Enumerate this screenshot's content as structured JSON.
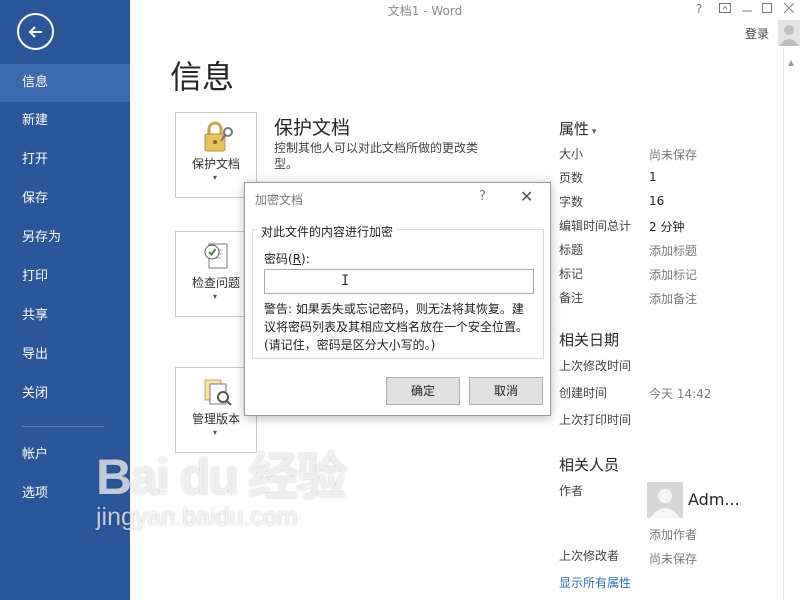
{
  "window": {
    "title": "文档1 - Word",
    "help": "?",
    "login": "登录"
  },
  "sidebar": {
    "items": [
      {
        "label": "信息"
      },
      {
        "label": "新建"
      },
      {
        "label": "打开"
      },
      {
        "label": "保存"
      },
      {
        "label": "另存为"
      },
      {
        "label": "打印"
      },
      {
        "label": "共享"
      },
      {
        "label": "导出"
      },
      {
        "label": "关闭"
      },
      {
        "label": "帐户"
      },
      {
        "label": "选项"
      }
    ]
  },
  "page": {
    "title": "信息"
  },
  "tiles": [
    {
      "label": "保护文档"
    },
    {
      "label": "检查问题"
    },
    {
      "label": "管理版本"
    }
  ],
  "protect": {
    "title": "保护文档",
    "description": "控制其他人可以对此文档所做的更改类型。"
  },
  "properties": {
    "heading": "属性",
    "rows": [
      {
        "label": "大小",
        "value": "尚未保存"
      },
      {
        "label": "页数",
        "value": "1"
      },
      {
        "label": "字数",
        "value": "16"
      },
      {
        "label": "编辑时间总计",
        "value": "2 分钟"
      },
      {
        "label": "标题",
        "value": "添加标题"
      },
      {
        "label": "标记",
        "value": "添加标记"
      },
      {
        "label": "备注",
        "value": "添加备注"
      }
    ],
    "dates_heading": "相关日期",
    "dates": [
      {
        "label": "上次修改时间",
        "value": ""
      },
      {
        "label": "创建时间",
        "value": "今天 14:42"
      },
      {
        "label": "上次打印时间",
        "value": ""
      }
    ],
    "people_heading": "相关人员",
    "author_label": "作者",
    "author_name": "Adm...",
    "add_author": "添加作者",
    "last_modified_by_label": "上次修改者",
    "last_modified_by_value": "尚未保存",
    "show_all": "显示所有属性"
  },
  "dialog": {
    "title": "加密文档",
    "help": "?",
    "group_title": "对此文件的内容进行加密",
    "password_label_pre": "密码(",
    "password_label_key": "R",
    "password_label_post": "):",
    "password_value": "",
    "warning": "警告: 如果丢失或忘记密码，则无法将其恢复。建议将密码列表及其相应文档名放在一个安全位置。(请记住，密码是区分大小写的。)",
    "ok": "确定",
    "cancel": "取消"
  },
  "watermark": {
    "brand": "Bai du 经验",
    "url": "jingyan.baidu.com"
  },
  "colors": {
    "sidebar": "#2b579a",
    "sidebar_active": "#3c6aae",
    "link": "#2b6cbc"
  }
}
